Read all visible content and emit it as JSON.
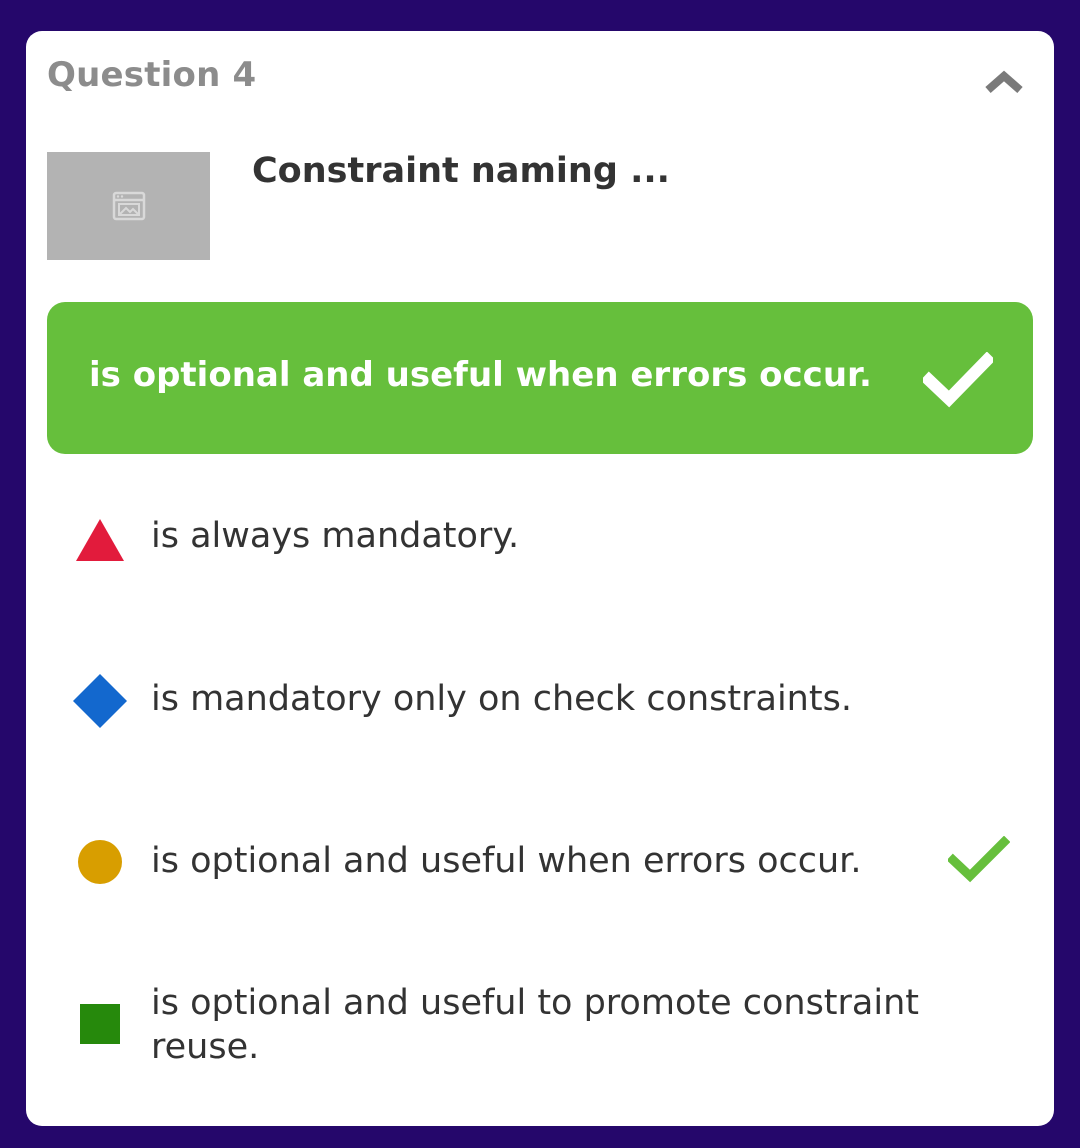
{
  "question": {
    "header": "Question 4",
    "text": "Constraint naming ...",
    "collapse_icon": "chevron-up-icon",
    "image_icon": "image-placeholder-icon"
  },
  "correct_answer": {
    "text": "is optional and useful when errors occur.",
    "icon": "check-icon",
    "color": "#66bf3c"
  },
  "options": [
    {
      "shape": "triangle",
      "color": "#e21b3c",
      "label": "is always mandatory.",
      "correct": false
    },
    {
      "shape": "diamond",
      "color": "#1368ce",
      "label": "is mandatory only on check constraints.",
      "correct": false
    },
    {
      "shape": "circle",
      "color": "#d89e00",
      "label": "is optional and useful when errors occur.",
      "correct": true
    },
    {
      "shape": "square",
      "color": "#26890c",
      "label": "is optional and useful to promote constraint reuse.",
      "correct": false
    }
  ],
  "colors": {
    "background": "#25076b",
    "card": "#ffffff",
    "header_text": "#8c8c8c",
    "body_text": "#333333"
  }
}
